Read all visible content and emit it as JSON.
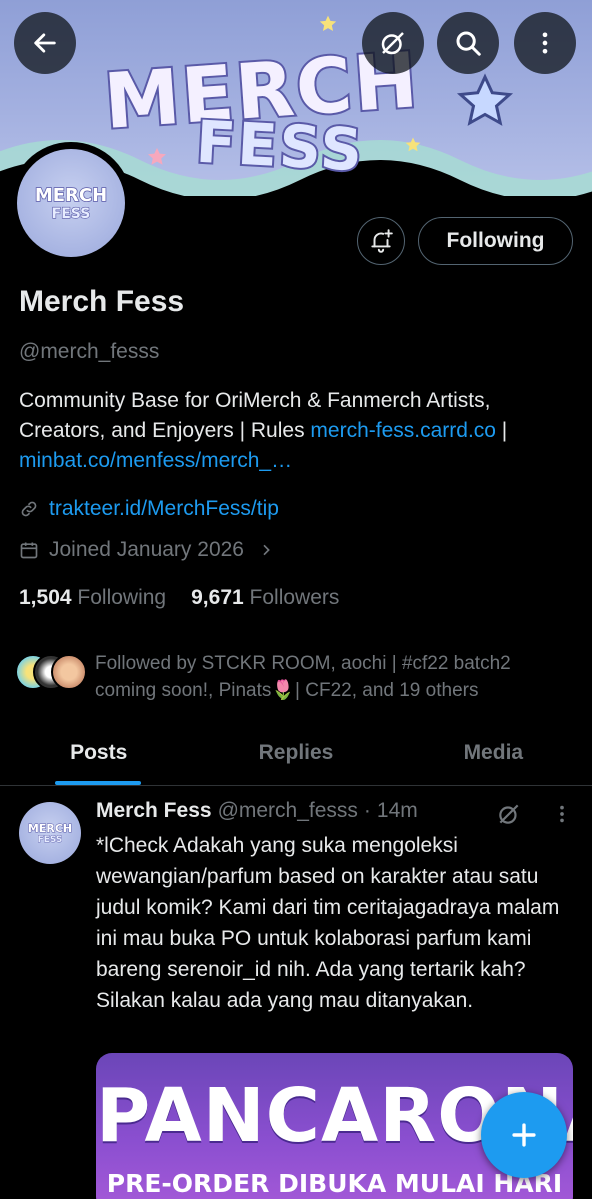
{
  "colors": {
    "accent": "#1d9bf0",
    "background": "#000000",
    "muted": "#71767b",
    "text": "#e7e9ea"
  },
  "banner": {
    "logo_line1": "MERCH",
    "logo_line2": "FESS"
  },
  "header": {
    "back_icon": "arrow-left-icon",
    "grok_icon": "grok-icon",
    "search_icon": "search-icon",
    "more_icon": "more-vertical-icon"
  },
  "avatar": {
    "line1": "MERCH",
    "line2": "FESS"
  },
  "actions": {
    "notify_icon": "bell-plus-icon",
    "following_label": "Following"
  },
  "profile": {
    "name": "Merch Fess",
    "handle": "@merch_fesss",
    "bio_text1": "Community Base for OriMerch & Fanmerch Artists, Creators, and Enjoyers | Rules ",
    "bio_link1": "merch-fess.carrd.co",
    "bio_sep": " | ",
    "bio_link2": "minbat.co/menfess/merch_…",
    "website": "trakteer.id/MerchFess/tip",
    "joined": "Joined January 2026"
  },
  "stats": {
    "following_count": "1,504",
    "following_label": "Following",
    "followers_count": "9,671",
    "followers_label": "Followers"
  },
  "followed_by": "Followed by STCKR ROOM, aochi | #cf22 batch2 coming soon!, Pinats🌷| CF22, and 19 others",
  "tabs": [
    {
      "label": "Posts"
    },
    {
      "label": "Replies"
    },
    {
      "label": "Media"
    }
  ],
  "tweet": {
    "author": "Merch Fess",
    "handle": "@merch_fesss",
    "dot": "·",
    "time": "14m",
    "text": "*lCheck Adakah yang suka mengoleksi wewangian/parfum based on karakter atau satu judul komik? Kami dari tim ceritajagadraya malam ini mau buka PO untuk kolaborasi parfum kami bareng serenoir_id nih. Ada yang tertarik kah? Silakan kalau ada yang mau ditanyakan.",
    "media_title": "PANCARONA",
    "media_subtitle": "PRE-ORDER DIBUKA MULAI HARI INI"
  },
  "fab": {
    "icon": "plus-icon"
  }
}
